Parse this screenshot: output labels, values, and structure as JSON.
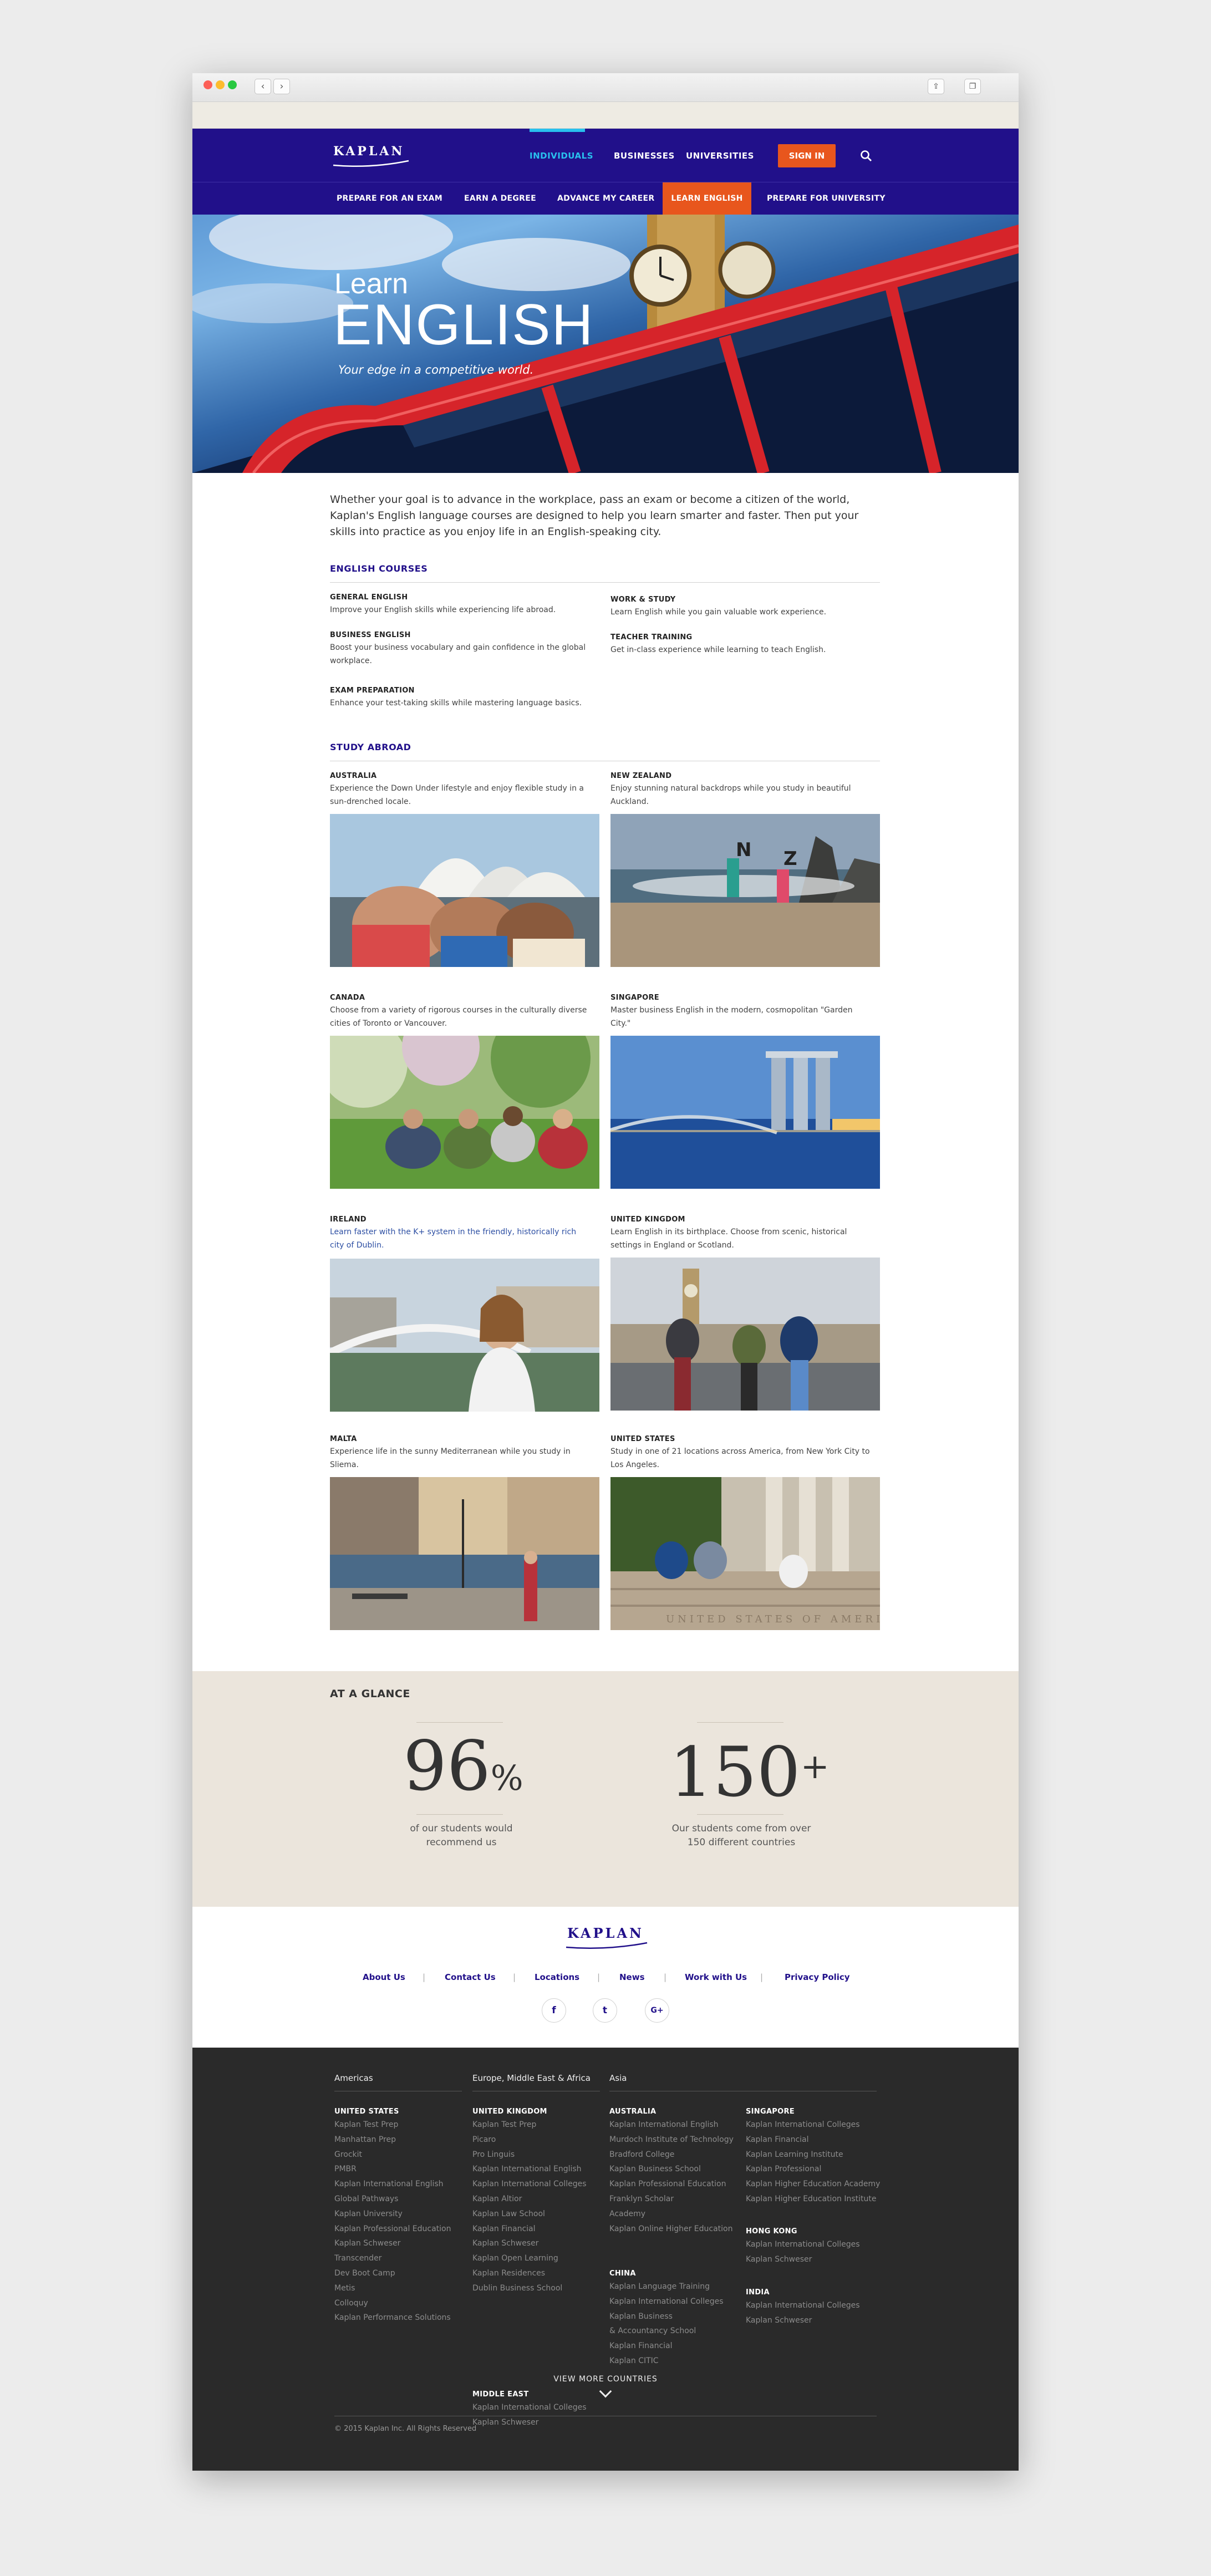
{
  "nav": {
    "logo": "KAPLAN",
    "links": [
      "INDIVIDUALS",
      "BUSINESSES",
      "UNIVERSITIES"
    ],
    "signin": "SIGN IN",
    "sub": [
      "PREPARE FOR AN EXAM",
      "EARN A DEGREE",
      "ADVANCE MY CAREER",
      "LEARN ENGLISH",
      "PREPARE FOR UNIVERSITY"
    ]
  },
  "hero": {
    "line1": "Learn",
    "line2": "ENGLISH",
    "tagline": "Your edge in a competitive world."
  },
  "intro": "Whether your goal is to advance in the workplace, pass an exam or become a citizen of the world, Kaplan's English language courses are designed to help you learn smarter and faster. Then put your skills into practice as you enjoy life in an English-speaking city.",
  "courses": {
    "heading": "ENGLISH COURSES",
    "items": [
      {
        "title": "GENERAL ENGLISH",
        "desc": "Improve your English skills while experiencing life abroad."
      },
      {
        "title": "WORK & STUDY",
        "desc": "Learn English while you gain valuable work experience."
      },
      {
        "title": "BUSINESS ENGLISH",
        "desc": "Boost your business vocabulary and gain confidence in the global workplace."
      },
      {
        "title": "TEACHER TRAINING",
        "desc": "Get in-class experience while learning to teach English."
      },
      {
        "title": "EXAM PREPARATION",
        "desc": "Enhance your test-taking skills while mastering language basics."
      }
    ]
  },
  "study": {
    "heading": "STUDY ABROAD",
    "items": [
      {
        "title": "AUSTRALIA",
        "desc": "Experience the Down Under lifestyle and enjoy flexible study in a sun-drenched locale."
      },
      {
        "title": "NEW ZEALAND",
        "desc": "Enjoy stunning natural backdrops while you study in beautiful Auckland."
      },
      {
        "title": "CANADA",
        "desc": "Choose from a variety of rigorous courses in the culturally diverse cities of Toronto or Vancouver."
      },
      {
        "title": "SINGAPORE",
        "desc": "Master business English in the modern, cosmopolitan \"Garden City.\""
      },
      {
        "title": "IRELAND",
        "desc": "Learn faster with the K+ system in the friendly, historically rich city of Dublin."
      },
      {
        "title": "UNITED KINGDOM",
        "desc": "Learn English in its birthplace. Choose from scenic, historical settings in England or Scotland."
      },
      {
        "title": "MALTA",
        "desc": "Experience life in the sunny Mediterranean while you study in Sliema."
      },
      {
        "title": "UNITED STATES",
        "desc": "Study in one of 21 locations across America, from New York City to Los Angeles."
      }
    ],
    "photo_letters": [
      "N",
      "Z"
    ],
    "us_photo_text": "UNITED STATES OF AMERICA"
  },
  "glance": {
    "heading": "AT A GLANCE",
    "stat1": {
      "value": "96",
      "unit": "%",
      "caption": "of our students would recommend us"
    },
    "stat2": {
      "value": "150",
      "unit": "+",
      "caption": "Our students come from over 150 different countries"
    }
  },
  "footer": {
    "logo": "KAPLAN",
    "links": [
      "About Us",
      "Contact Us",
      "Locations",
      "News",
      "Work with Us",
      "Privacy Policy"
    ],
    "separator": "|",
    "social": [
      "f",
      "t",
      "G+"
    ],
    "regions": [
      "Americas",
      "Europe, Middle East & Africa",
      "Asia"
    ],
    "columns": {
      "us": {
        "country": "UNITED STATES",
        "items": [
          "Kaplan Test Prep",
          "Manhattan Prep",
          "Grockit",
          "PMBR",
          "Kaplan International English",
          "Global Pathways",
          "Kaplan University",
          "Kaplan Professional Education",
          "Kaplan Schweser",
          "Transcender",
          "Dev Boot Camp",
          "Metis",
          "Colloquy",
          "Kaplan Performance Solutions"
        ]
      },
      "uk": {
        "country": "UNITED KINGDOM",
        "items": [
          "Kaplan Test Prep",
          "Picaro",
          "Pro Linguis",
          "Kaplan International English",
          "Kaplan International Colleges",
          "Kaplan Altior",
          "Kaplan Law School",
          "Kaplan Financial",
          "Kaplan Schweser",
          "Kaplan Open Learning",
          "Kaplan Residences",
          "Dublin Business School"
        ]
      },
      "me": {
        "country": "MIDDLE EAST",
        "items": [
          "Kaplan International Colleges",
          "Kaplan Schweser"
        ]
      },
      "au": {
        "country": "AUSTRALIA",
        "items": [
          "Kaplan International English",
          "Murdoch Institute of Technology",
          "Bradford College",
          "Kaplan Business School",
          "Kaplan Professional Education",
          "Franklyn Scholar",
          "Academy",
          "Kaplan Online Higher Education"
        ]
      },
      "cn": {
        "country": "CHINA",
        "items": [
          "Kaplan Language Training",
          "Kaplan International Colleges",
          "Kaplan Business",
          "& Accountancy School",
          "Kaplan Financial",
          "Kaplan CITIC"
        ]
      },
      "sg": {
        "country": "SINGAPORE",
        "items": [
          "Kaplan International Colleges",
          "Kaplan Financial",
          "Kaplan Learning Institute",
          "Kaplan Professional",
          "Kaplan Higher Education Academy",
          "Kaplan Higher Education Institute"
        ]
      },
      "hk": {
        "country": "HONG KONG",
        "items": [
          "Kaplan International Colleges",
          "Kaplan Schweser"
        ]
      },
      "in": {
        "country": "INDIA",
        "items": [
          "Kaplan International Colleges",
          "Kaplan Schweser"
        ]
      }
    },
    "view_more": "VIEW MORE COUNTRIES",
    "copyright": "© 2015 Kaplan Inc. All Rights Reserved"
  },
  "colors": {
    "brand": "#21108a",
    "accent": "#e8561d",
    "active": "#29c0ee",
    "dark": "#2a2a2a",
    "glance_bg": "#ebe5dc"
  }
}
